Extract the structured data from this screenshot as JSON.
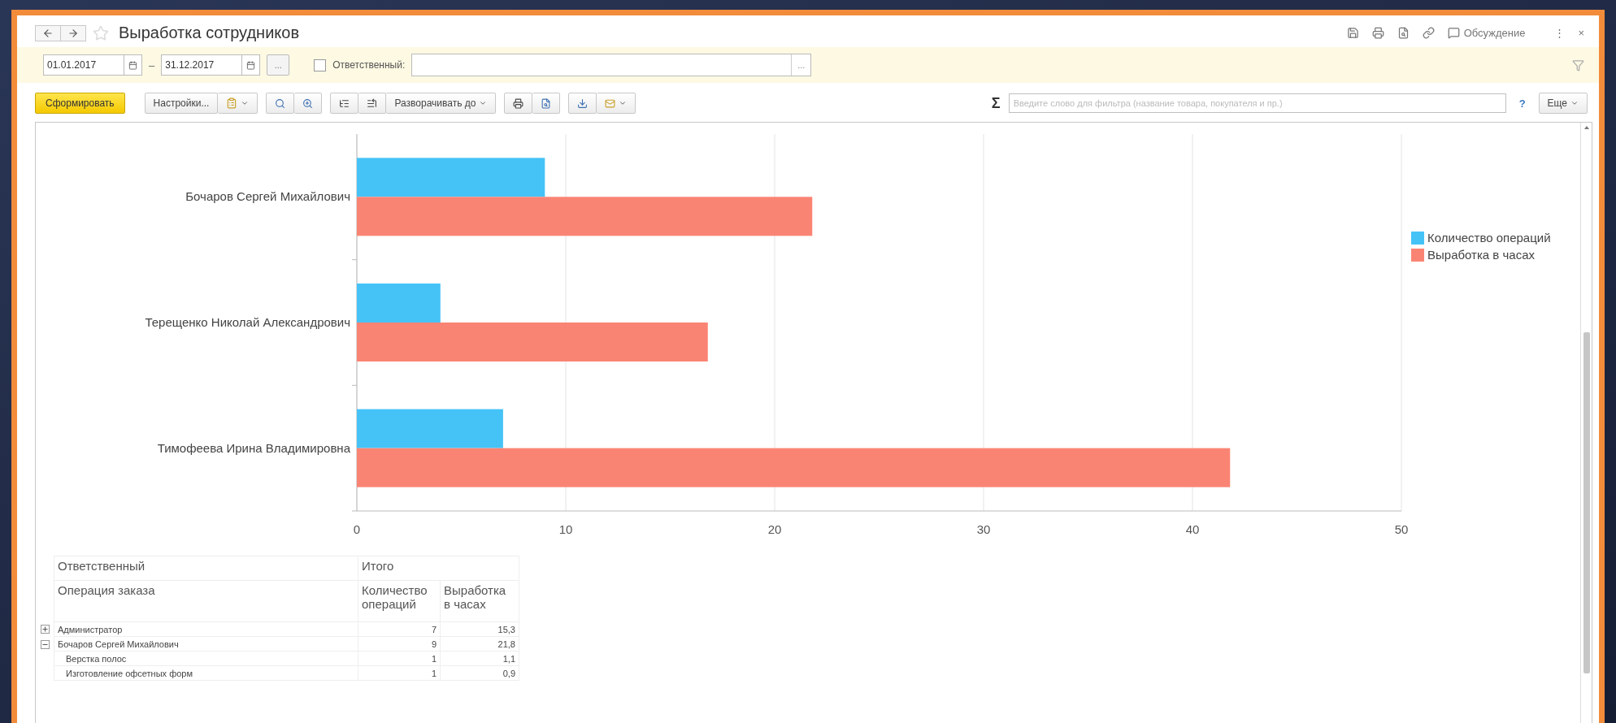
{
  "window": {
    "title": "Выработка сотрудников",
    "favorite": false,
    "discussion": "Обсуждение",
    "menu": "⋮",
    "close": "×"
  },
  "filters": {
    "date_from": "01.01.2017",
    "separator": "–",
    "date_to": "31.12.2017",
    "period_button": "...",
    "responsible": {
      "label": "Ответственный:",
      "checked": false,
      "select_button": "..."
    }
  },
  "toolbar": {
    "generate": "Сформировать",
    "settings": "Настройки...",
    "expand_to": "Разворачивать до",
    "sum": "Σ",
    "search": {
      "placeholder": "Введите слово для фильтра (название товара, покупателя и пр.)"
    },
    "help": "?",
    "more": "Еще"
  },
  "chart": {
    "chart_data": {
      "type": "bar",
      "orientation": "horizontal",
      "categories": [
        "Бочаров Сергей Михайлович",
        "Терещенко Николай Александрович",
        "Тимофеева Ирина Владимировна"
      ],
      "series": [
        {
          "name": "Количество операций",
          "color": "#45c3f7",
          "values": [
            9,
            4,
            7
          ]
        },
        {
          "name": "Выработка в часах",
          "color": "#fa8474",
          "values": [
            21.8,
            16.8,
            41.8
          ]
        }
      ],
      "xlim": [
        0,
        50
      ],
      "xticks": [
        0,
        10,
        20,
        30,
        40,
        50
      ],
      "grid": true,
      "legend": "right"
    }
  },
  "table": {
    "group_label": "Ответственный",
    "subgroup_label": "Операция заказа",
    "total_label": "Итого",
    "columns": [
      "Количество операций",
      "Выработка в часах"
    ],
    "rows": [
      {
        "name": "Администратор",
        "count": "7",
        "hours": "15,3",
        "expanded": false
      },
      {
        "name": "Бочаров Сергей Михайлович",
        "count": "9",
        "hours": "21,8",
        "expanded": true,
        "children": [
          {
            "name": "Верстка полос",
            "count": "1",
            "hours": "1,1"
          },
          {
            "name": "Изготовление офсетных форм",
            "count": "1",
            "hours": "0,9"
          }
        ]
      }
    ]
  }
}
